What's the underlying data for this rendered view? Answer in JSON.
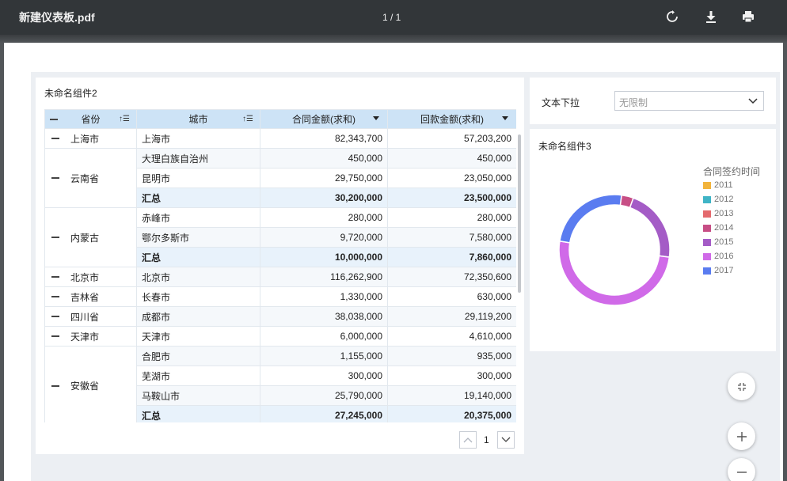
{
  "viewer": {
    "title": "新建仪表板.pdf",
    "page_indicator": "1 / 1",
    "icons": [
      "rotate-icon",
      "download-icon",
      "print-icon"
    ]
  },
  "table_widget": {
    "title": "未命名组件2",
    "columns": [
      "省份",
      "城市",
      "合同金额(求和)",
      "回款金额(求和)"
    ],
    "rows": [
      {
        "province": "上海市",
        "cities": [
          {
            "city": "上海市",
            "contract": "82,343,700",
            "payback": "57,203,200",
            "total": false
          }
        ]
      },
      {
        "province": "云南省",
        "cities": [
          {
            "city": "大理白族自治州",
            "contract": "450,000",
            "payback": "450,000",
            "total": false
          },
          {
            "city": "昆明市",
            "contract": "29,750,000",
            "payback": "23,050,000",
            "total": false
          },
          {
            "city": "汇总",
            "contract": "30,200,000",
            "payback": "23,500,000",
            "total": true
          }
        ]
      },
      {
        "province": "内蒙古",
        "cities": [
          {
            "city": "赤峰市",
            "contract": "280,000",
            "payback": "280,000",
            "total": false
          },
          {
            "city": "鄂尔多斯市",
            "contract": "9,720,000",
            "payback": "7,580,000",
            "total": false
          },
          {
            "city": "汇总",
            "contract": "10,000,000",
            "payback": "7,860,000",
            "total": true
          }
        ]
      },
      {
        "province": "北京市",
        "cities": [
          {
            "city": "北京市",
            "contract": "116,262,900",
            "payback": "72,350,600",
            "total": false
          }
        ]
      },
      {
        "province": "吉林省",
        "cities": [
          {
            "city": "长春市",
            "contract": "1,330,000",
            "payback": "630,000",
            "total": false
          }
        ]
      },
      {
        "province": "四川省",
        "cities": [
          {
            "city": "成都市",
            "contract": "38,038,000",
            "payback": "29,119,200",
            "total": false
          }
        ]
      },
      {
        "province": "天津市",
        "cities": [
          {
            "city": "天津市",
            "contract": "6,000,000",
            "payback": "4,610,000",
            "total": false
          }
        ]
      },
      {
        "province": "安徽省",
        "cities": [
          {
            "city": "合肥市",
            "contract": "1,155,000",
            "payback": "935,000",
            "total": false
          },
          {
            "city": "芜湖市",
            "contract": "300,000",
            "payback": "300,000",
            "total": false
          },
          {
            "city": "马鞍山市",
            "contract": "25,790,000",
            "payback": "19,140,000",
            "total": false
          },
          {
            "city": "汇总",
            "contract": "27,245,000",
            "payback": "20,375,000",
            "total": true
          }
        ]
      }
    ],
    "pagination": {
      "current": "1"
    }
  },
  "filter_widget": {
    "label": "文本下拉",
    "placeholder": "无限制"
  },
  "chart_widget": {
    "title": "未命名组件3",
    "legend_title": "合同签约时间"
  },
  "chart_data": {
    "type": "pie",
    "title": "未命名组件3",
    "legend_title": "合同签约时间",
    "legend_placement": "right",
    "series": [
      {
        "name": "2011",
        "value": 0.0,
        "color": "#f2b43c"
      },
      {
        "name": "2012",
        "value": 0.0,
        "color": "#3fb4c6"
      },
      {
        "name": "2013",
        "value": 0.0,
        "color": "#e46a6e"
      },
      {
        "name": "2014",
        "value": 3.5,
        "color": "#c74e85"
      },
      {
        "name": "2015",
        "value": 21.5,
        "color": "#a45cc6"
      },
      {
        "name": "2016",
        "value": 50.5,
        "color": "#d06ae8"
      },
      {
        "name": "2017",
        "value": 24.5,
        "color": "#5a7cf0"
      }
    ]
  },
  "zoom_controls": {
    "icons": [
      "fit-screen-icon",
      "zoom-in-icon",
      "zoom-out-icon"
    ]
  }
}
